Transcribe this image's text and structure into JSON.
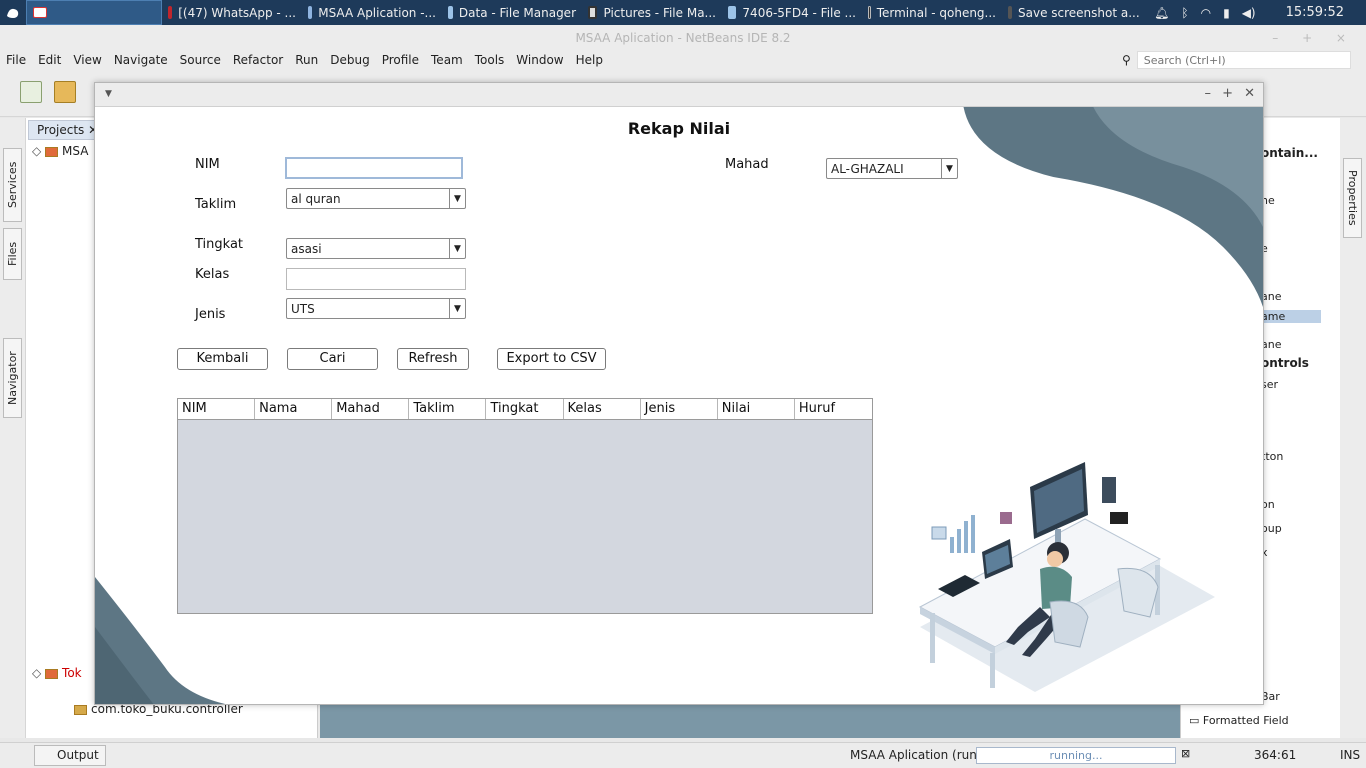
{
  "taskbar": {
    "items": [
      "[(47) WhatsApp - ...",
      "MSAA Aplication -...",
      "Data - File Manager",
      "Pictures - File Ma...",
      "7406-5FD4 - File ...",
      "Terminal - qoheng...",
      "Save screenshot a..."
    ],
    "clock": "15:59:52"
  },
  "ide": {
    "title": "MSAA Aplication - NetBeans IDE 8.2",
    "menu": [
      "File",
      "Edit",
      "View",
      "Navigate",
      "Source",
      "Refactor",
      "Run",
      "Debug",
      "Profile",
      "Team",
      "Tools",
      "Window",
      "Help"
    ],
    "search_placeholder": "Search (Ctrl+I)",
    "left_tabs": [
      "Services",
      "Files",
      "Navigator"
    ],
    "projects_tab": "Projects",
    "projects": {
      "root1": "MSA",
      "root2": "Tok",
      "controller_pkg": "com.toko_buku.controller"
    },
    "right_tab": "Properties",
    "palette_items": [
      "ontain...",
      "ne",
      "e",
      "ane",
      "ame",
      "ane",
      "ontrols",
      "ser",
      "tton",
      "on",
      "oup",
      "x",
      "Bar",
      "Formatted Field"
    ],
    "status": {
      "output_tab": "Output",
      "run_label": "MSAA Aplication (run)",
      "progress_text": "running...",
      "position": "364:61",
      "mode": "INS"
    }
  },
  "app": {
    "title": "Rekap Nilai",
    "labels": {
      "nim": "NIM",
      "taklim": "Taklim",
      "tingkat": "Tingkat",
      "kelas": "Kelas",
      "jenis": "Jenis",
      "mahad": "Mahad"
    },
    "fields": {
      "nim_value": "",
      "kelas_value": "",
      "taklim_selected": "al quran",
      "tingkat_selected": "asasi",
      "jenis_selected": "UTS",
      "mahad_selected": "AL-GHAZALI"
    },
    "buttons": {
      "kembali": "Kembali",
      "cari": "Cari",
      "refresh": "Refresh",
      "export": "Export to CSV"
    },
    "table": {
      "columns": [
        "NIM",
        "Nama",
        "Mahad",
        "Taklim",
        "Tingkat",
        "Kelas",
        "Jenis",
        "Nilai",
        "Huruf"
      ],
      "rows": []
    },
    "colors": {
      "wave_dark": "#5d7684",
      "wave_light": "#c7d2d9",
      "table_bg": "#d3d7df"
    }
  }
}
